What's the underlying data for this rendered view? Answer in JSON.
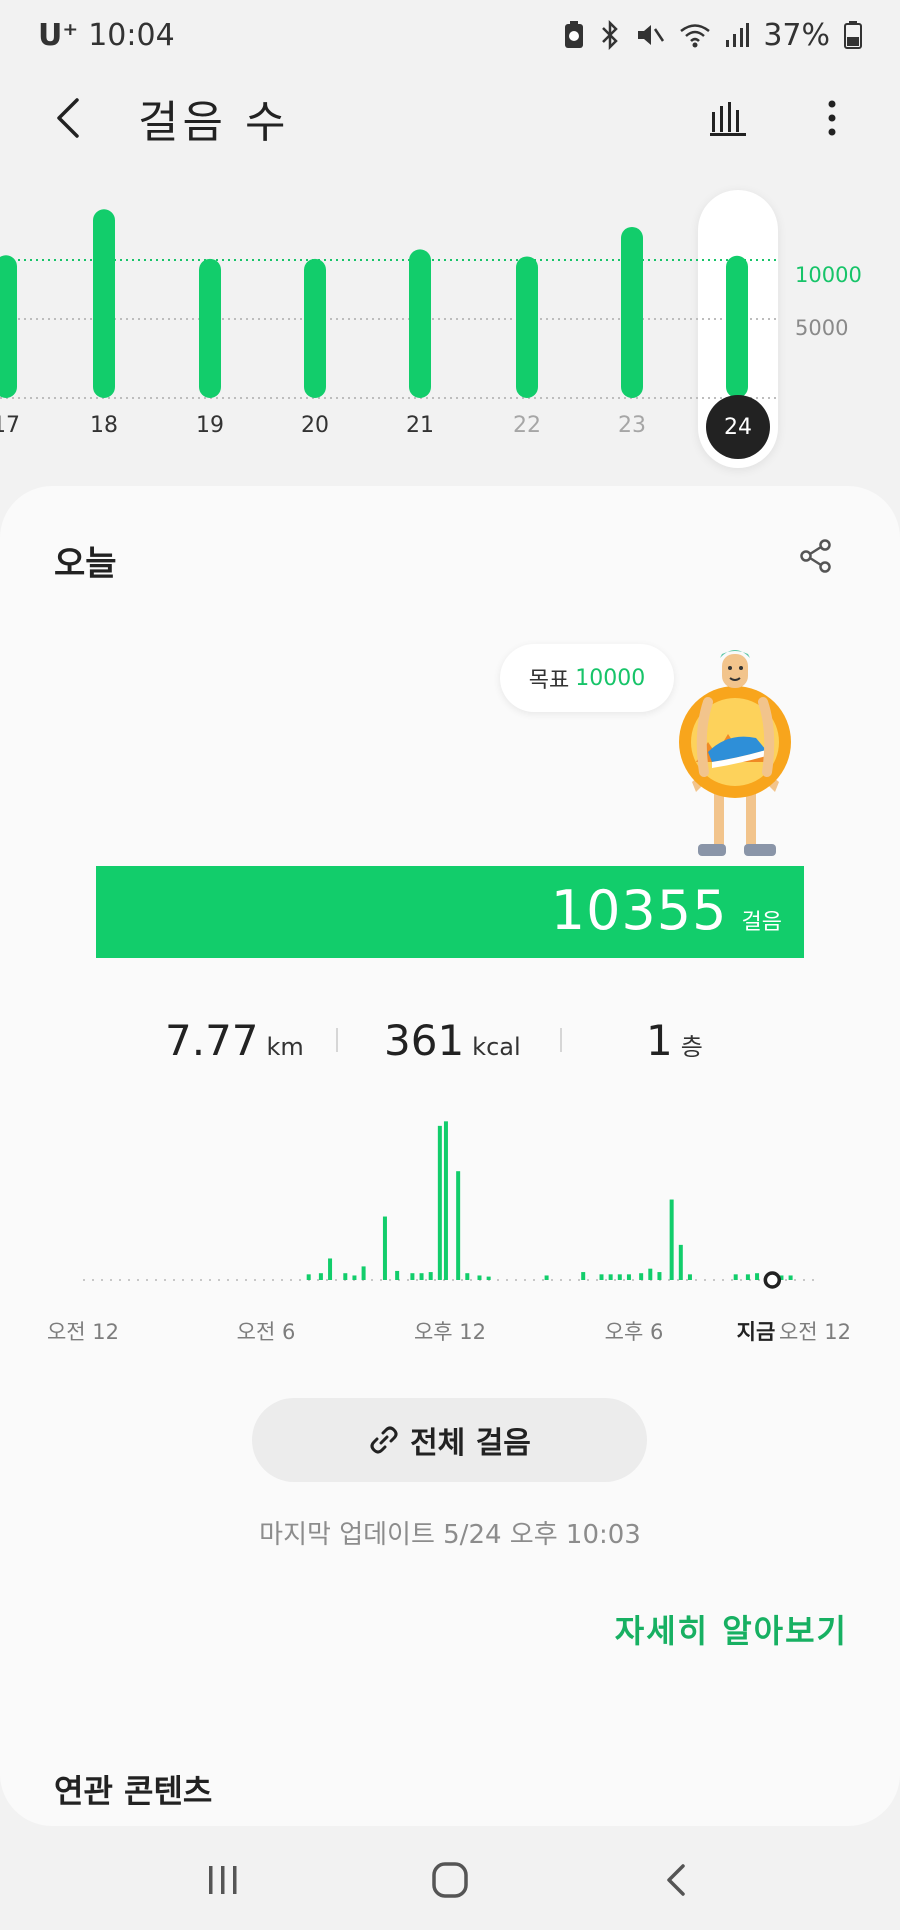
{
  "status_bar": {
    "carrier": "U⁺",
    "time": "10:04",
    "battery": "37%",
    "icons": [
      "battery-saver-icon",
      "bluetooth-icon",
      "mute-icon",
      "wifi-icon",
      "signal-icon",
      "battery-icon"
    ]
  },
  "header": {
    "title": "걸음 수",
    "back_icon": "chevron-left-icon",
    "chart_icon": "bar-chart-icon",
    "more_icon": "more-vertical-icon"
  },
  "week_chart": {
    "goal_label": "10000",
    "half_label": "5000",
    "colors": {
      "bar": "#12cd6b",
      "goal_line": "#17c469",
      "grid": "#bdbdbd"
    }
  },
  "chart_data": [
    {
      "type": "bar",
      "categories": [
        "17",
        "18",
        "19",
        "20",
        "21",
        "22",
        "23",
        "24"
      ],
      "values": [
        10400,
        14300,
        10100,
        10100,
        10900,
        10300,
        12800,
        10355
      ],
      "selected": "24",
      "future": [
        "22",
        "23"
      ],
      "reference_lines": [
        10000,
        5000
      ],
      "ylim": [
        0,
        15000
      ]
    },
    {
      "type": "bar",
      "categories": [
        "오전 12",
        "오전 6",
        "오후 12",
        "오후 6",
        "지금",
        "오전 12"
      ],
      "x": [
        7.4,
        7.8,
        8.1,
        8.6,
        8.9,
        9.2,
        9.9,
        10.3,
        10.8,
        11.1,
        11.4,
        11.7,
        11.9,
        12.3,
        12.6,
        13.0,
        13.3,
        15.2,
        16.4,
        17.0,
        17.3,
        17.6,
        17.9,
        18.3,
        18.6,
        18.9,
        19.3,
        19.6,
        19.9,
        21.4,
        21.8,
        22.1,
        22.5,
        22.9,
        23.2
      ],
      "values": [
        10,
        12,
        38,
        12,
        8,
        24,
        112,
        16,
        12,
        12,
        14,
        272,
        280,
        192,
        12,
        8,
        6,
        8,
        14,
        10,
        10,
        10,
        10,
        12,
        20,
        14,
        142,
        62,
        10,
        10,
        10,
        12,
        10,
        8,
        8
      ],
      "xlim": [
        0,
        24
      ],
      "ylim": [
        0,
        300
      ],
      "now": 22.6
    }
  ],
  "today": {
    "title": "오늘",
    "share_icon": "share-icon",
    "goal_prefix": "목표",
    "goal_value": "10000",
    "steps": "10355",
    "steps_unit": "걸음",
    "distance": "7.77",
    "distance_unit": "km",
    "calories": "361",
    "calories_unit": "kcal",
    "floors": "1",
    "floors_unit": "층"
  },
  "hourly": {
    "labels": {
      "am12": "오전 12",
      "am6": "오전 6",
      "pm12": "오후 12",
      "pm6": "오후 6",
      "now": "지금",
      "am12_end": "오전 12"
    }
  },
  "actions": {
    "all_steps": "전체 걸음",
    "last_update": "마지막 업데이트 5/24 오후 10:03",
    "learn_more": "자세히 알아보기",
    "related": "연관 콘텐츠"
  },
  "nav": {
    "recents_icon": "recent-apps-icon",
    "home_icon": "home-icon",
    "back_icon": "back-icon"
  }
}
